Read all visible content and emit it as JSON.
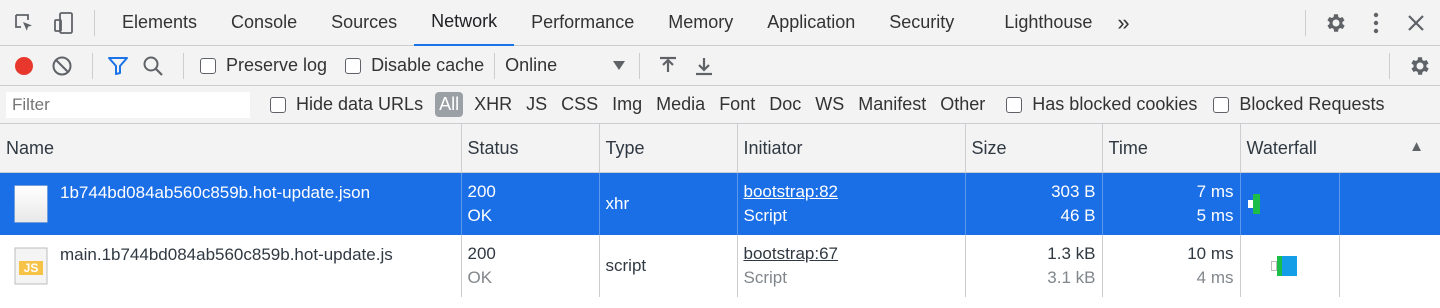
{
  "tabs": [
    "Elements",
    "Console",
    "Sources",
    "Network",
    "Performance",
    "Memory",
    "Application",
    "Security",
    "Lighthouse"
  ],
  "more_tabs": "»",
  "toolbar": {
    "preserve_log": "Preserve log",
    "disable_cache": "Disable cache",
    "throttle": "Online"
  },
  "filterbar": {
    "placeholder": "Filter",
    "hide_data_urls": "Hide data URLs",
    "types": [
      "All",
      "XHR",
      "JS",
      "CSS",
      "Img",
      "Media",
      "Font",
      "Doc",
      "WS",
      "Manifest",
      "Other"
    ],
    "has_blocked_cookies": "Has blocked cookies",
    "blocked_requests": "Blocked Requests"
  },
  "table": {
    "headers": [
      "Name",
      "Status",
      "Type",
      "Initiator",
      "Size",
      "Time",
      "Waterfall"
    ],
    "sort_indicator": "▲",
    "rows": [
      {
        "name": "1b744bd084ab560c859b.hot-update.json",
        "status": "200",
        "status_text": "OK",
        "type": "xhr",
        "initiator": "bootstrap:82",
        "initiator_type": "Script",
        "size": "303 B",
        "size_content": "46 B",
        "time": "7 ms",
        "latency": "5 ms",
        "selected": true
      },
      {
        "name": "main.1b744bd084ab560c859b.hot-update.js",
        "status": "200",
        "status_text": "OK",
        "type": "script",
        "initiator": "bootstrap:67",
        "initiator_type": "Script",
        "size": "1.3 kB",
        "size_content": "3.1 kB",
        "time": "10 ms",
        "latency": "4 ms",
        "selected": false
      }
    ]
  },
  "icons": {
    "js_label": "JS"
  },
  "colors": {
    "accent": "#1a73e8",
    "selected_row": "#1a6ee6",
    "record": "#e8372c",
    "waterfall_green": "#1dbd4a",
    "waterfall_blue": "#159ee8"
  }
}
